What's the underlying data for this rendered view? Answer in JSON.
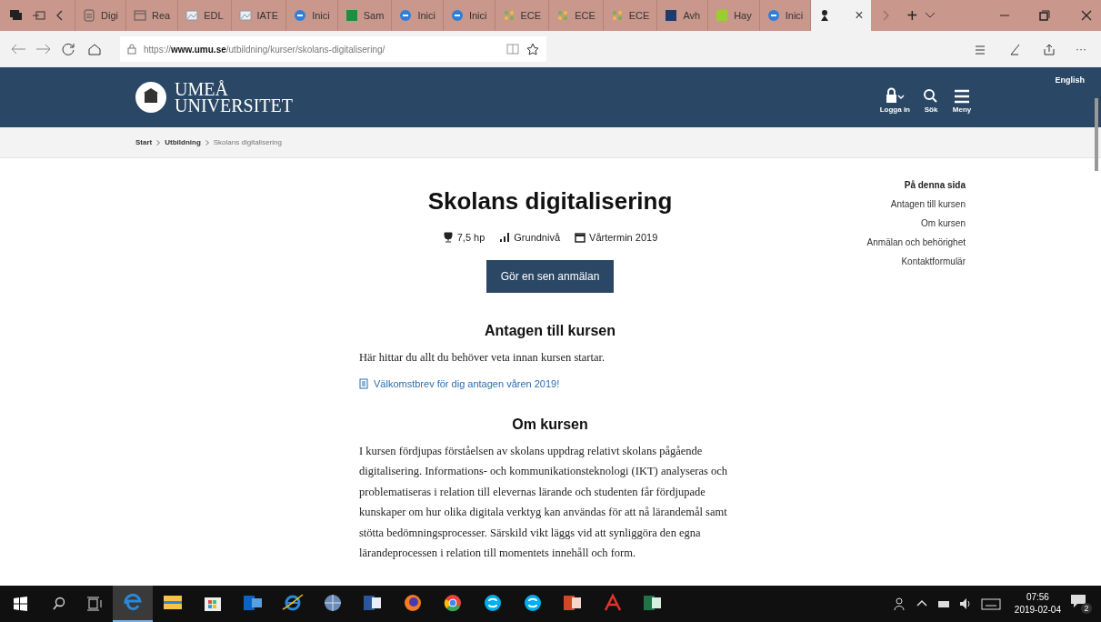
{
  "browser": {
    "tabs": [
      {
        "label": "Digi",
        "kind": "doc",
        "selected": false
      },
      {
        "label": "Rea",
        "kind": "window",
        "selected": false
      },
      {
        "label": "EDL",
        "kind": "image",
        "selected": false
      },
      {
        "label": "IATE",
        "kind": "image",
        "selected": false
      },
      {
        "label": "Inici",
        "kind": "circle",
        "selected": false
      },
      {
        "label": "Sam",
        "kind": "sheet",
        "selected": false
      },
      {
        "label": "Inici",
        "kind": "circle",
        "selected": false
      },
      {
        "label": "Inici",
        "kind": "circle",
        "selected": false
      },
      {
        "label": "ECE",
        "kind": "dots",
        "selected": false
      },
      {
        "label": "ECE",
        "kind": "dots",
        "selected": false
      },
      {
        "label": "ECE",
        "kind": "dots",
        "selected": false
      },
      {
        "label": "Avh",
        "kind": "book",
        "selected": false
      },
      {
        "label": "Hay",
        "kind": "leaf",
        "selected": false
      },
      {
        "label": "Inici",
        "kind": "circle",
        "selected": false
      },
      {
        "kind": "figure",
        "selected": true,
        "close": "×"
      }
    ],
    "new_tab": "+",
    "url": "https://**www.umu.se**/utbildning/kurser/skolans-digitalisering/",
    "more": "···"
  },
  "header": {
    "logo_line_1": "UMEÅ",
    "logo_line_2": "UNIVERSITET",
    "language": "English",
    "actions": [
      {
        "label": "Logga in",
        "kind": "lock"
      },
      {
        "label": "Sök",
        "kind": "search"
      },
      {
        "label": "Meny",
        "kind": "menu"
      }
    ]
  },
  "breadcrumb": [
    {
      "label": "Start",
      "current": false
    },
    {
      "label": "Utbildning",
      "current": false
    },
    {
      "label": "Skolans digitalisering",
      "current": true
    }
  ],
  "course": {
    "title": "Skolans digitalisering",
    "facts": [
      {
        "kind": "credits",
        "text": "7,5 hp"
      },
      {
        "kind": "level",
        "text": "Grundnivå"
      },
      {
        "kind": "term",
        "text": "Vårtermin 2019"
      }
    ],
    "apply_button": "Gör en sen anmälan",
    "sections": [
      {
        "heading": "Antagen till kursen",
        "text": "Här hittar du allt du behöver veta innan kursen startar.",
        "link": "Välkomstbrev för dig antagen våren 2019!"
      },
      {
        "heading": "Om kursen",
        "text": "I kursen fördjupas förståelsen av skolans uppdrag relativt skolans pågående digitalisering. Informations- och kommunikationsteknologi (IKT) analyseras och problematiseras i relation till elevernas lärande och studenten får fördjupade kunskaper om hur olika digitala verktyg kan användas för att nå lärandemål samt stötta bedömningsprocesser. Särskild vikt läggs vid att synliggöra den egna lärandeprocessen i relation till momentets innehåll och form."
      }
    ]
  },
  "on_this_page": {
    "title": "På denna sida",
    "links": [
      "Antagen till kursen",
      "Om kursen",
      "Anmälan och behörighet",
      "Kontaktformulär"
    ]
  },
  "taskbar": {
    "apps": [
      {
        "kind": "edge",
        "selected": true
      },
      {
        "kind": "explorer",
        "selected": false
      },
      {
        "kind": "store",
        "selected": false
      },
      {
        "kind": "outlook",
        "selected": false
      },
      {
        "kind": "ie",
        "selected": false
      },
      {
        "kind": "globe",
        "selected": false
      },
      {
        "kind": "word",
        "selected": false
      },
      {
        "kind": "firefox",
        "selected": false
      },
      {
        "kind": "chrome",
        "selected": false
      },
      {
        "kind": "skype",
        "selected": false
      },
      {
        "kind": "skype",
        "selected": false
      },
      {
        "kind": "powerpoint",
        "selected": false
      },
      {
        "kind": "acrobat",
        "selected": false
      },
      {
        "kind": "excel",
        "selected": false
      }
    ],
    "time": "07:56",
    "date": "2019-02-04",
    "notifications": "2"
  }
}
